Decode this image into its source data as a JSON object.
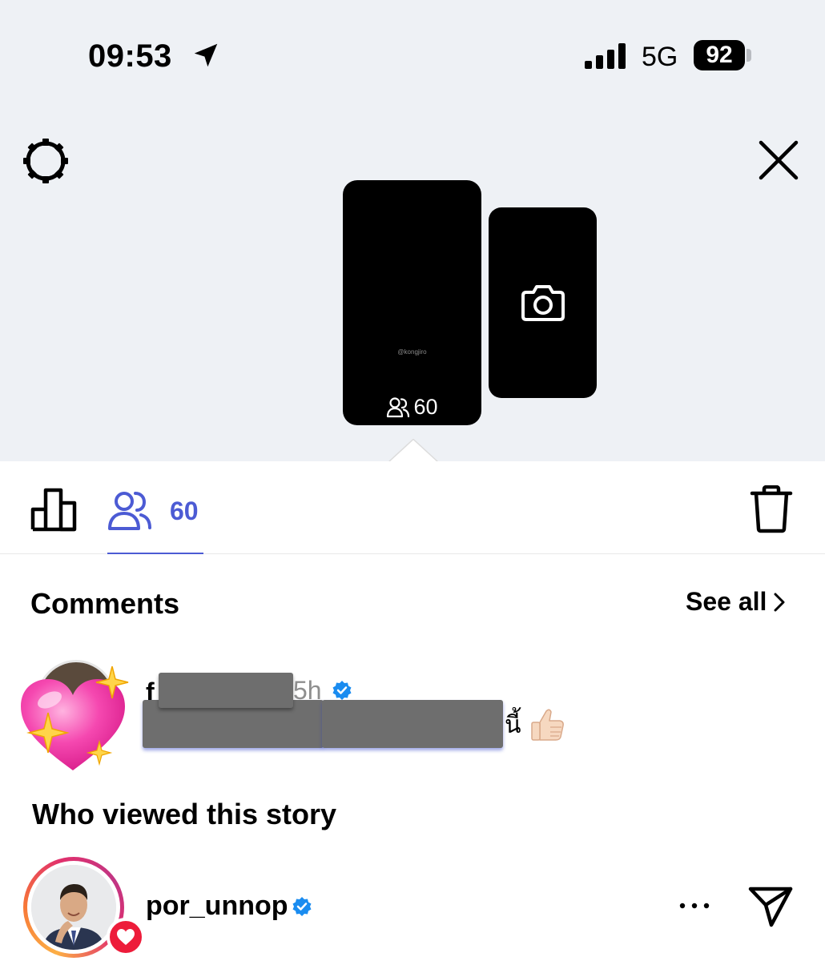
{
  "status_bar": {
    "time": "09:53",
    "network": "5G",
    "battery": "92"
  },
  "header": {
    "settings_icon": "gear-icon",
    "close_icon": "close-icon"
  },
  "story": {
    "watermark": "@kongjiro",
    "viewer_count": "60"
  },
  "tabs": {
    "insights_icon": "bar-chart-icon",
    "viewers_icon": "people-icon",
    "viewers_count": "60",
    "delete_icon": "trash-icon"
  },
  "comments": {
    "title": "Comments",
    "see_all": "See all",
    "items": [
      {
        "username_start": "f",
        "time": "5h",
        "verified": true,
        "text_tail": "นี้"
      }
    ]
  },
  "viewers": {
    "title": "Who viewed this story",
    "items": [
      {
        "username": "por_unnop",
        "verified": true,
        "liked": true
      }
    ]
  },
  "colors": {
    "accent": "#4c5bd4",
    "verified": "#1a8cf0",
    "like": "#ed1c3a",
    "top_bg": "#eef1f5"
  }
}
